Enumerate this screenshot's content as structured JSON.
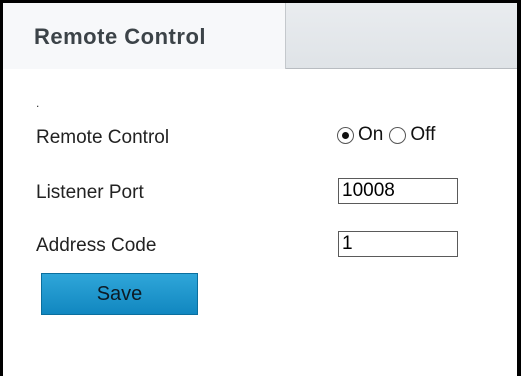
{
  "tab": {
    "title": "Remote Control"
  },
  "content": {
    "dot": ".",
    "remote_control": {
      "label": "Remote Control",
      "options": [
        {
          "label": "On",
          "checked": true
        },
        {
          "label": "Off",
          "checked": false
        }
      ]
    },
    "listener_port": {
      "label": "Listener Port",
      "value": "10008"
    },
    "address_code": {
      "label": "Address Code",
      "value": "1"
    },
    "save_label": "Save"
  },
  "colors": {
    "save_button": "#1e98cf",
    "tab_bar": "#e3e6ea",
    "active_tab": "#f7f8fa"
  }
}
